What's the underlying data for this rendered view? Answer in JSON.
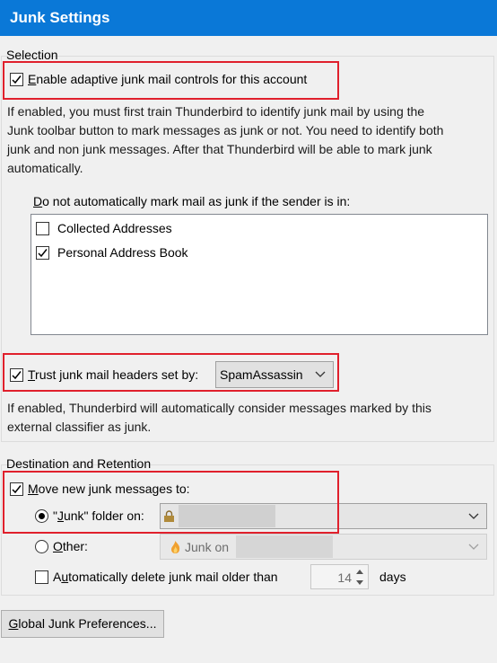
{
  "title": "Junk Settings",
  "selection": {
    "group_title": "Selection",
    "adaptive": {
      "label": "Enable adaptive junk mail controls for this account",
      "checked": true
    },
    "adaptive_description": [
      "If enabled, you must first train Thunderbird to identify junk mail by using the",
      "Junk toolbar button to mark messages as junk or not. You need to identify both",
      "junk and non junk messages. After that Thunderbird will be able to mark junk",
      "automatically."
    ],
    "whitelist_label": "Do not automatically mark mail as junk if the sender is in:",
    "address_books": [
      {
        "label": "Collected Addresses",
        "checked": false
      },
      {
        "label": "Personal Address Book",
        "checked": true
      }
    ],
    "trust_headers": {
      "label": "Trust junk mail headers set by:",
      "checked": true,
      "selected": "SpamAssassin"
    },
    "trust_description": [
      "If enabled, Thunderbird will automatically consider messages marked by this",
      "external classifier as junk."
    ]
  },
  "destination": {
    "group_title": "Destination and Retention",
    "move": {
      "label": "Move new junk messages to:",
      "checked": true
    },
    "junk_folder_option": {
      "label": "\"Junk\" folder on:",
      "selected": true
    },
    "other_option": {
      "label": "Other:",
      "selected": false,
      "value": "Junk on"
    },
    "auto_delete": {
      "label": "Automatically delete junk mail older than",
      "checked": false,
      "days_value": "14",
      "days_unit": "days"
    }
  },
  "global_button_label": "Global Junk Preferences..."
}
